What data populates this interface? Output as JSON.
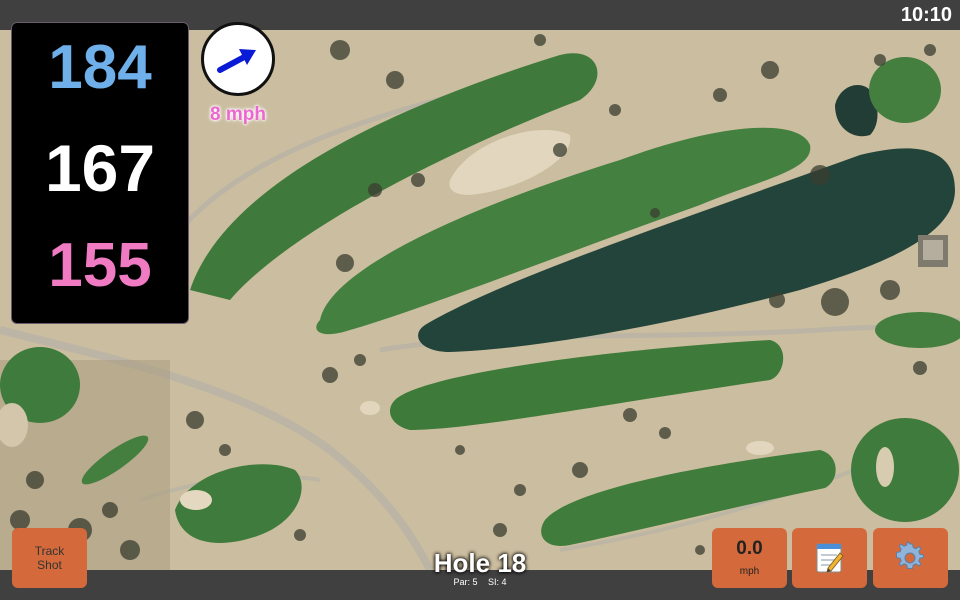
{
  "status_bar": {
    "time": "10:10"
  },
  "yardages": {
    "back": "184",
    "middle": "167",
    "front": "155"
  },
  "wind": {
    "speed_label": "8 mph",
    "direction_icon": "wind-arrow-icon",
    "arrow_color": "#0a1bd6"
  },
  "hole": {
    "title": "Hole 18",
    "par": "Par: 5",
    "si": "SI: 4"
  },
  "buttons": {
    "track_shot": "Track Shot",
    "speed_value": "0.0",
    "speed_unit": "mph",
    "notes_icon": "notepad-icon",
    "settings_icon": "gear-icon"
  },
  "colors": {
    "back_yardage": "#6fb0ea",
    "middle_yardage": "#ffffff",
    "front_yardage": "#f07bc3",
    "button": "#d46a3b",
    "fairway": "#3f7a3c",
    "water": "#23443a",
    "sand": "#cdbfa1"
  }
}
